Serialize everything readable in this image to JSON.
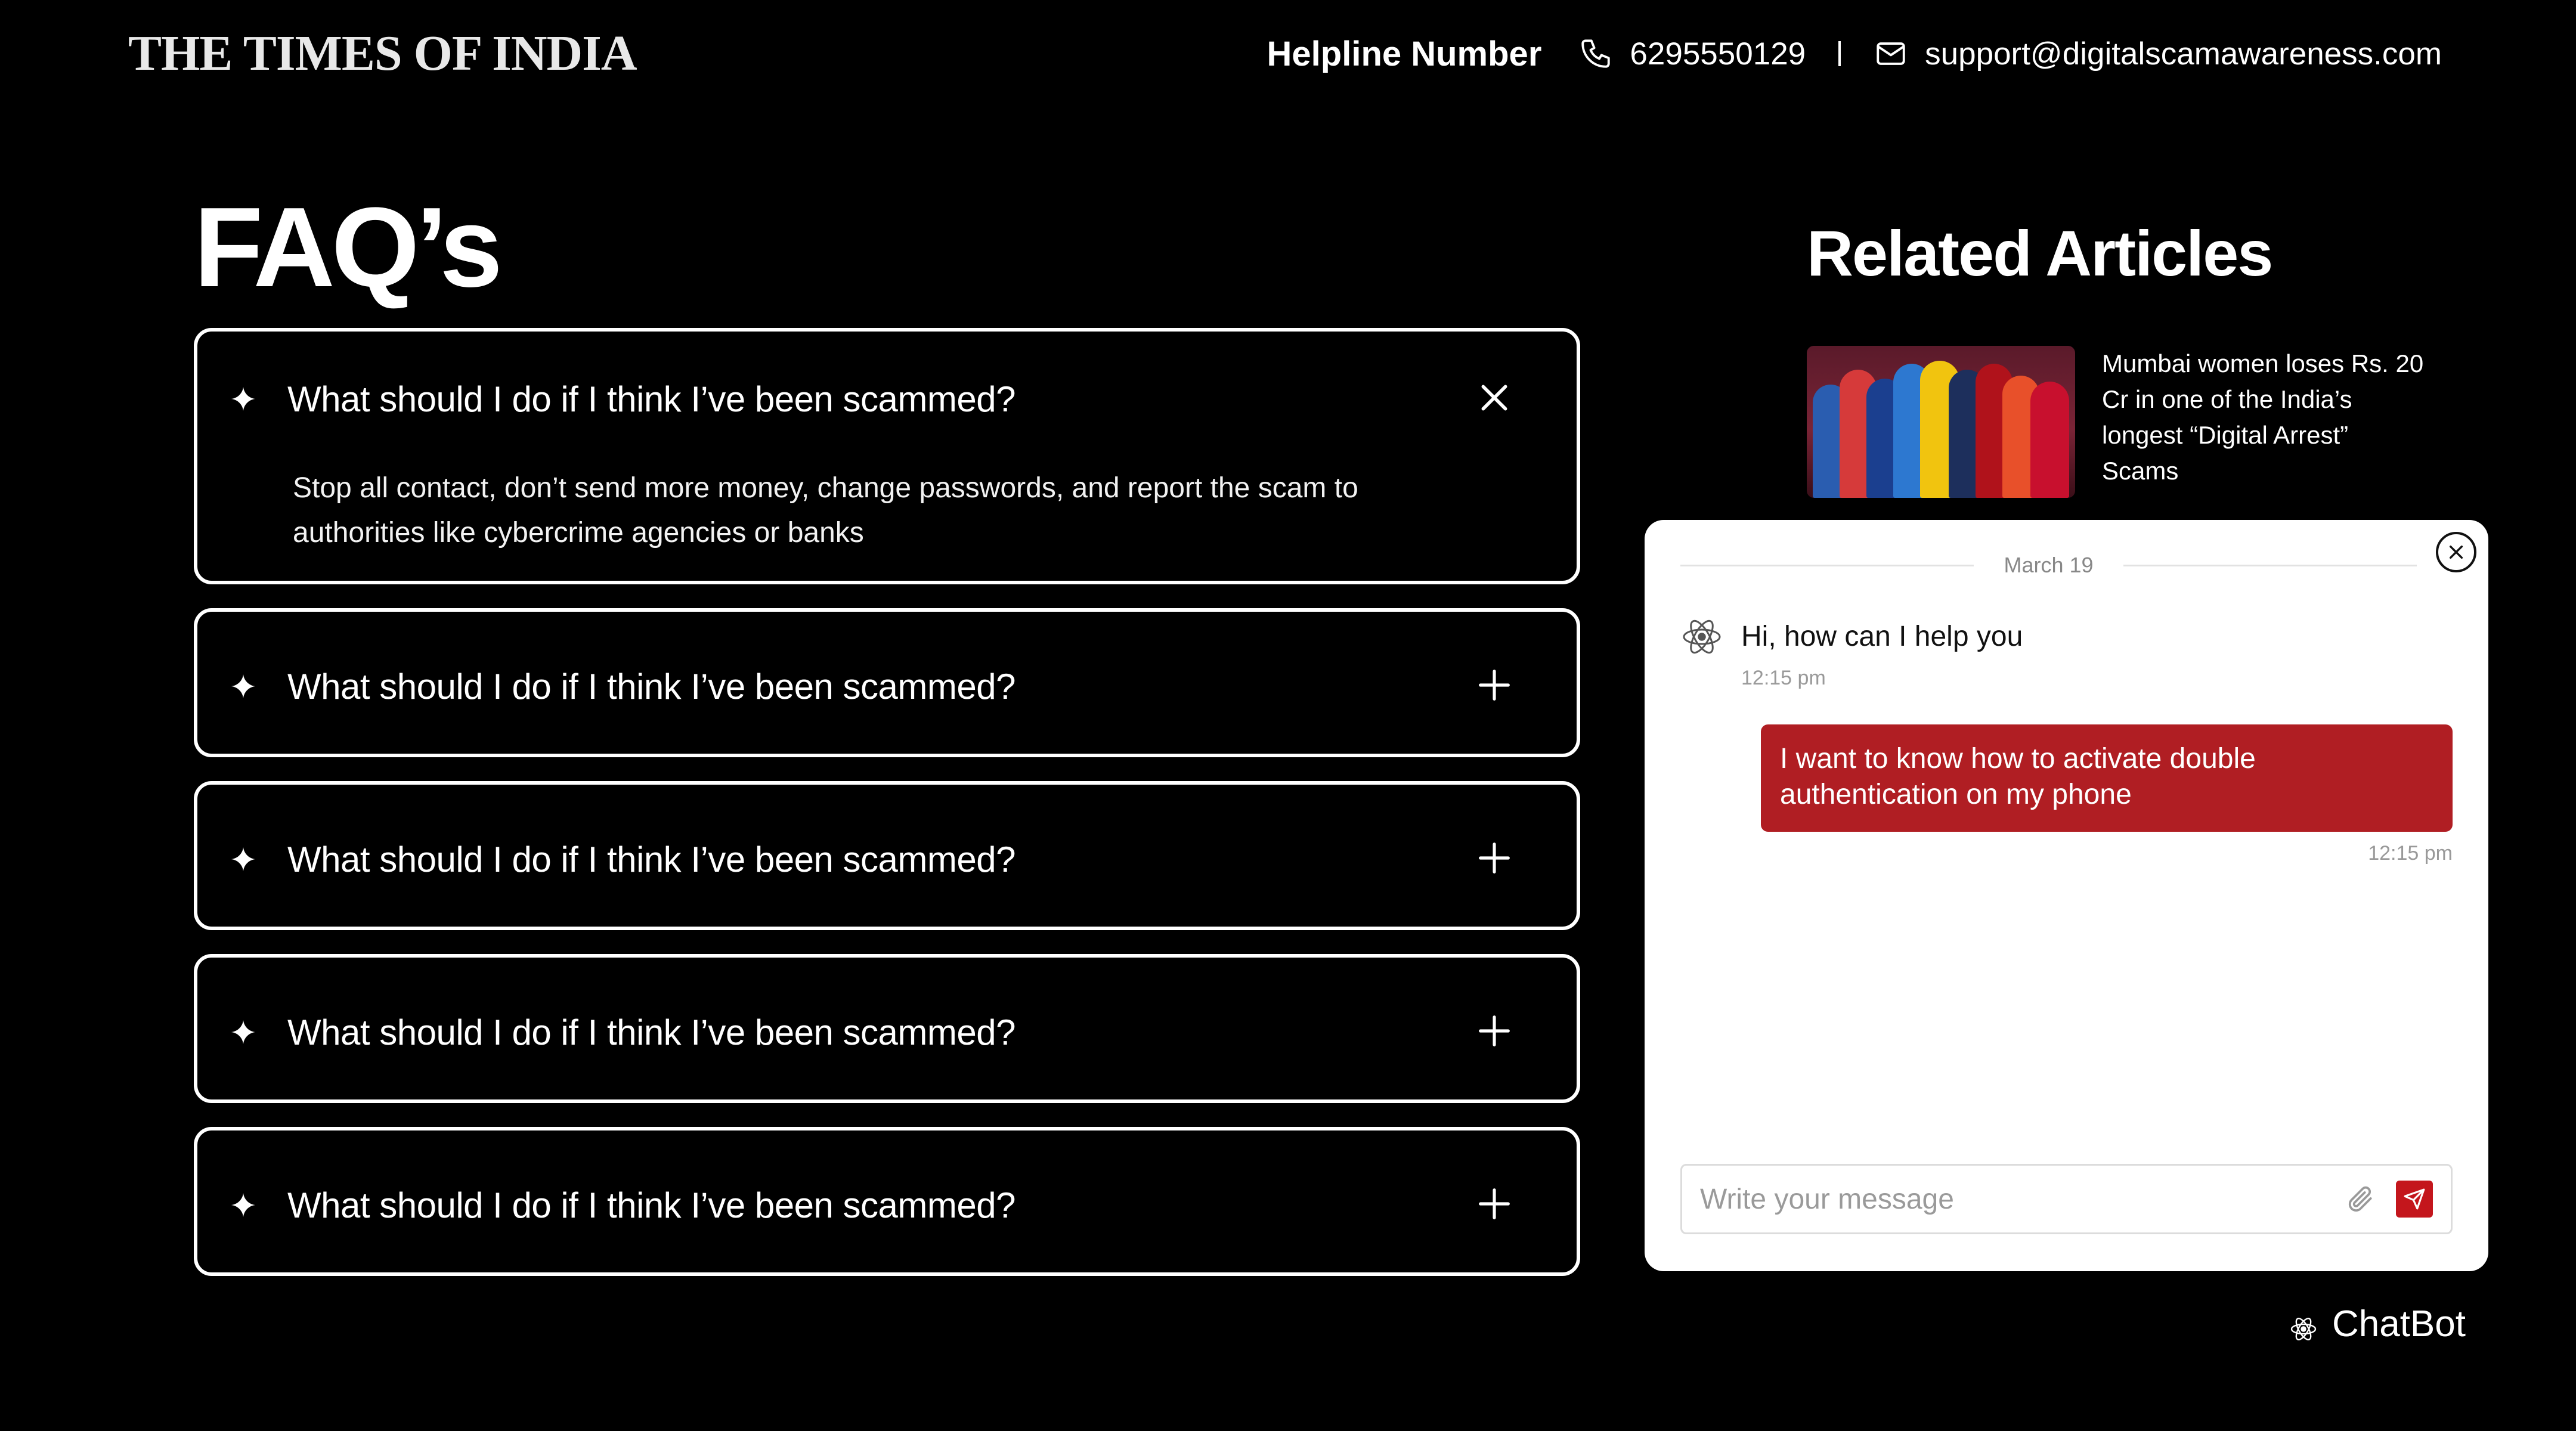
{
  "header": {
    "logo": "THE TIMES OF INDIA",
    "helpline_label": "Helpline Number",
    "phone": "6295550129",
    "email": "support@digitalscamawareness.com",
    "phone_icon": "phone-icon",
    "email_icon": "mail-icon"
  },
  "faq": {
    "title": "FAQ’s",
    "items": [
      {
        "question": "What should I do if I think I’ve been scammed?",
        "answer": "Stop all contact, don’t send more money, change passwords, and report the scam to authorities like cybercrime agencies or banks",
        "expanded": true
      },
      {
        "question": "What should I do if I think I’ve been scammed?",
        "expanded": false
      },
      {
        "question": "What should I do if I think I’ve been scammed?",
        "expanded": false
      },
      {
        "question": "What should I do if I think I’ve been scammed?",
        "expanded": false
      },
      {
        "question": "What should I do if I think I’ve been scammed?",
        "expanded": false
      }
    ]
  },
  "related": {
    "title": "Related Articles",
    "articles": [
      {
        "headline": "Mumbai women loses Rs. 20 Cr in one of the India’s longest “Digital Arrest” Scams"
      }
    ]
  },
  "chat": {
    "date": "March 19",
    "bot_message": "Hi, how can I help you",
    "bot_time": "12:15 pm",
    "user_message": "I want to know how to activate double authentication on my phone",
    "user_time": "12:15 pm",
    "input_placeholder": "Write your message",
    "colors": {
      "user_bubble": "#b01e23",
      "send_button": "#c4161c"
    }
  },
  "launcher": {
    "label": "ChatBot"
  }
}
